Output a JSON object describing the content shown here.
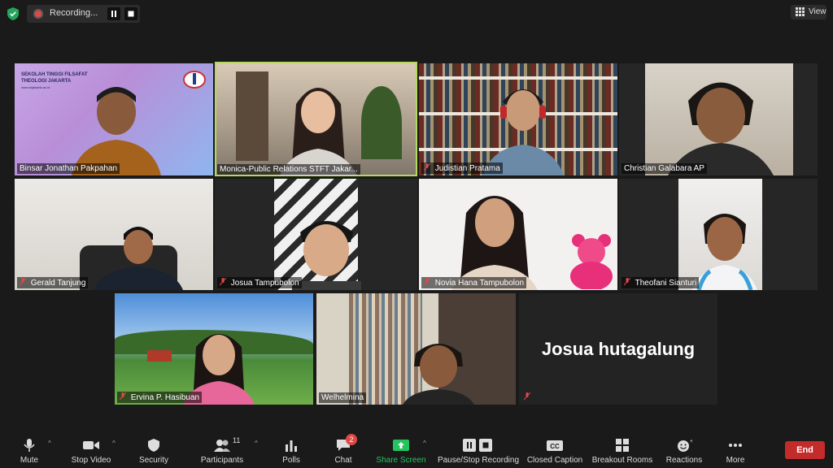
{
  "recording": {
    "label": "Recording..."
  },
  "view": {
    "label": "View"
  },
  "participants_tiles": [
    {
      "name": "Binsar Jonathan Pakpahan",
      "muted": false
    },
    {
      "name": "Monica-Public Relations STFT Jakar...",
      "muted": false
    },
    {
      "name": "Judistian Pratama",
      "muted": true
    },
    {
      "name": "Christian Galabara AP",
      "muted": false
    },
    {
      "name": "Gerald Tanjung",
      "muted": true
    },
    {
      "name": "Josua Tampubolon",
      "muted": true
    },
    {
      "name": "Novia  Hana Tampubolon",
      "muted": true
    },
    {
      "name": "Theofani Sianturi",
      "muted": true
    },
    {
      "name": "Ervina P. Hasibuan",
      "muted": true
    },
    {
      "name": "Welhelmina",
      "muted": false
    },
    {
      "name": "Josua hutagalung",
      "muted": true
    }
  ],
  "slide_text": {
    "line1": "SEKOLAH TINGGI FILSAFAT",
    "line2": "THEOLOGI JAKARTA",
    "url": "www.sttjakarta.ac.id"
  },
  "toolbar": {
    "mute": "Mute",
    "stop_video": "Stop Video",
    "security": "Security",
    "participants": "Participants",
    "participants_count": "11",
    "polls": "Polls",
    "chat": "Chat",
    "chat_badge": "2",
    "share_screen": "Share Screen",
    "pause_stop_recording": "Pause/Stop Recording",
    "closed_caption": "Closed Caption",
    "breakout_rooms": "Breakout Rooms",
    "reactions": "Reactions",
    "more": "More",
    "end": "End"
  },
  "colors": {
    "background": "#1a1a1a",
    "active_speaker": "#b6d861",
    "share_green": "#23c45e",
    "end_red": "#c42b2b"
  }
}
